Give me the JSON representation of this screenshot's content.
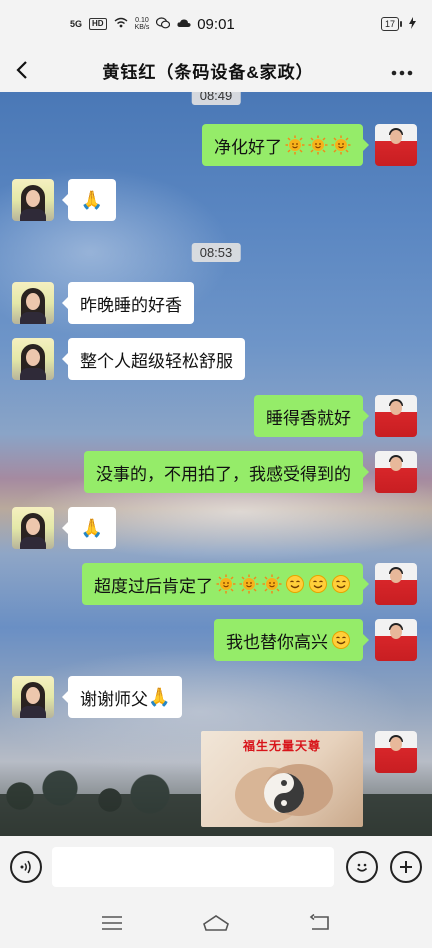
{
  "status_bar": {
    "network": "5G",
    "hd": "HD",
    "speed_value": "0.10",
    "speed_unit": "KB/s",
    "time": "09:01",
    "battery": "17"
  },
  "header": {
    "title": "黄钰红（条码设备&家政）"
  },
  "chat": {
    "timestamps": [
      "08:49",
      "08:53"
    ],
    "messages": [
      {
        "side": "right",
        "text": "净化好了",
        "emojis": [
          "sun",
          "sun",
          "sun"
        ]
      },
      {
        "side": "left",
        "text": "",
        "emojis": [
          "pray"
        ]
      },
      {
        "side": "left",
        "text": "昨晚睡的好香",
        "emojis": []
      },
      {
        "side": "left",
        "text": "整个人超级轻松舒服",
        "emojis": []
      },
      {
        "side": "right",
        "text": "睡得香就好",
        "emojis": []
      },
      {
        "side": "right",
        "text": "没事的，不用拍了，我感受得到的",
        "emojis": []
      },
      {
        "side": "left",
        "text": "",
        "emojis": [
          "pray"
        ]
      },
      {
        "side": "right",
        "text": "超度过后肯定了",
        "emojis": [
          "sun",
          "sun",
          "sun",
          "smile",
          "smile",
          "smile"
        ]
      },
      {
        "side": "right",
        "text": "我也替你高兴",
        "emojis": [
          "smile"
        ]
      },
      {
        "side": "left",
        "text": "谢谢师父",
        "emojis": [
          "pray"
        ]
      },
      {
        "side": "right",
        "image_caption": "福生无量天尊"
      }
    ]
  },
  "colors": {
    "sent_bubble": "#95ec69",
    "received_bubble": "#ffffff",
    "image_caption": "#d8141a"
  },
  "icons": {
    "back": "back-arrow-icon",
    "more": "more-dots-icon",
    "voice": "voice-icon",
    "emoji": "emoji-icon",
    "add": "plus-icon",
    "nav_menu": "menu-icon",
    "nav_home": "home-icon",
    "nav_back": "back-nav-icon"
  }
}
